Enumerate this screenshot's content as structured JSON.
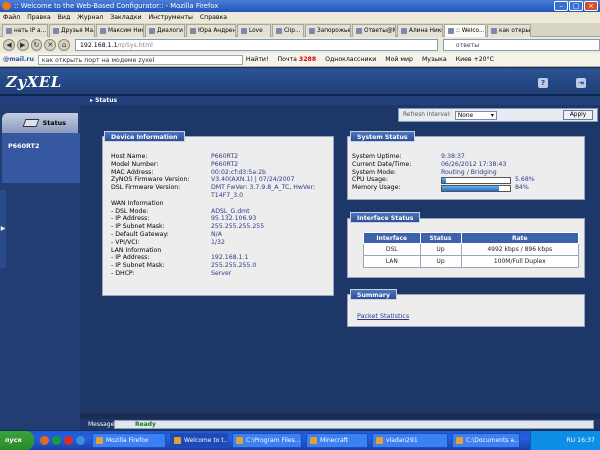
{
  "browser": {
    "window_title": ":: Welcome to the Web-Based Configurator:: - Mozilla Firefox",
    "menu": [
      "Файл",
      "Правка",
      "Вид",
      "Журнал",
      "Закладки",
      "Инструменты",
      "Справка"
    ],
    "tabs": [
      "нать IP а...",
      "Друзья Ма...",
      "Максим Ник...",
      "Диалоги",
      "Юра Андренко",
      "Love",
      "Clip...",
      "Запорожье",
      "Ответы@Ma...",
      "Алина Нико...",
      ":: Welco...",
      "как открыт..."
    ],
    "active_tab_index": 10,
    "url_domain": "192.168.1.1",
    "url_path": "/rpSys.html",
    "search_text": "ответы",
    "mail_search": "как открыть порт на модеме zyxel",
    "mail_find": "Найти!",
    "mail_items": [
      "Почта",
      "Одноклассники",
      "Мой мир",
      "Музыка",
      "Киев +20°C"
    ],
    "mail_count": "3288",
    "mail_logo": "@mail.ru"
  },
  "router": {
    "brand": "ZyXEL",
    "breadcrumb": "Status",
    "sidebar_tab": "Status",
    "device": "P660RT2",
    "refresh_label": "Refresh Interval:",
    "refresh_value": "None",
    "apply": "Apply",
    "device_info": {
      "title": "Device Information",
      "rows": [
        {
          "k": "Host Name:",
          "v": "P660RT2"
        },
        {
          "k": "Model Number:",
          "v": "P660RT2"
        },
        {
          "k": "MAC Address:",
          "v": "00:02:cf:d3:5a:2b"
        },
        {
          "k": "ZyNOS Firmware Version:",
          "v": "V3.40(AXN.1) | 07/24/2007"
        },
        {
          "k": "DSL Firmware Version:",
          "v": "DMT FwVer: 3.7.9.8_A_TC, HwVer: T14F7_3.0"
        },
        {
          "k": "WAN Information",
          "v": ""
        },
        {
          "k": "- DSL Mode:",
          "v": "ADSL_G.dmt"
        },
        {
          "k": "- IP Address:",
          "v": "95.132.106.93"
        },
        {
          "k": "- IP Subnet Mask:",
          "v": "255.255.255.255"
        },
        {
          "k": "- Default Gateway:",
          "v": "N/A"
        },
        {
          "k": "- VPI/VCI:",
          "v": "1/32"
        },
        {
          "k": "LAN Information",
          "v": ""
        },
        {
          "k": "- IP Address:",
          "v": "192.168.1.1"
        },
        {
          "k": "- IP Subnet Mask:",
          "v": "255.255.255.0"
        },
        {
          "k": "- DHCP:",
          "v": "Server"
        }
      ]
    },
    "system_status": {
      "title": "System Status",
      "uptime_k": "System Uptime:",
      "uptime_v": "9:38:37",
      "date_k": "Current Date/Time:",
      "date_v": "06/26/2012 17:38:43",
      "mode_k": "System Mode:",
      "mode_v": "Routing / Bridging",
      "cpu_k": "CPU Usage:",
      "cpu_v": "5.68%",
      "cpu_fraction": 0.0568,
      "mem_k": "Memory Usage:",
      "mem_v": "84%",
      "mem_fraction": 0.84
    },
    "interface_status": {
      "title": "Interface Status",
      "headers": [
        "Interface",
        "Status",
        "Rate"
      ],
      "rows": [
        [
          "DSL",
          "Up",
          "4992 kbps / 896 kbps"
        ],
        [
          "LAN",
          "Up",
          "100M/Full Duplex"
        ]
      ]
    },
    "summary": {
      "title": "Summary",
      "link": "Packet Statistics"
    },
    "message_label": "Message",
    "message": "Ready"
  },
  "taskbar": {
    "start": "пуск",
    "items": [
      "Mozilla Firefox",
      "Welcome to t...",
      "C:\\Program Files...",
      "Minecraft",
      "vladan291",
      "C:\\Documents a..."
    ],
    "clock": "16:37",
    "lang": "RU"
  }
}
